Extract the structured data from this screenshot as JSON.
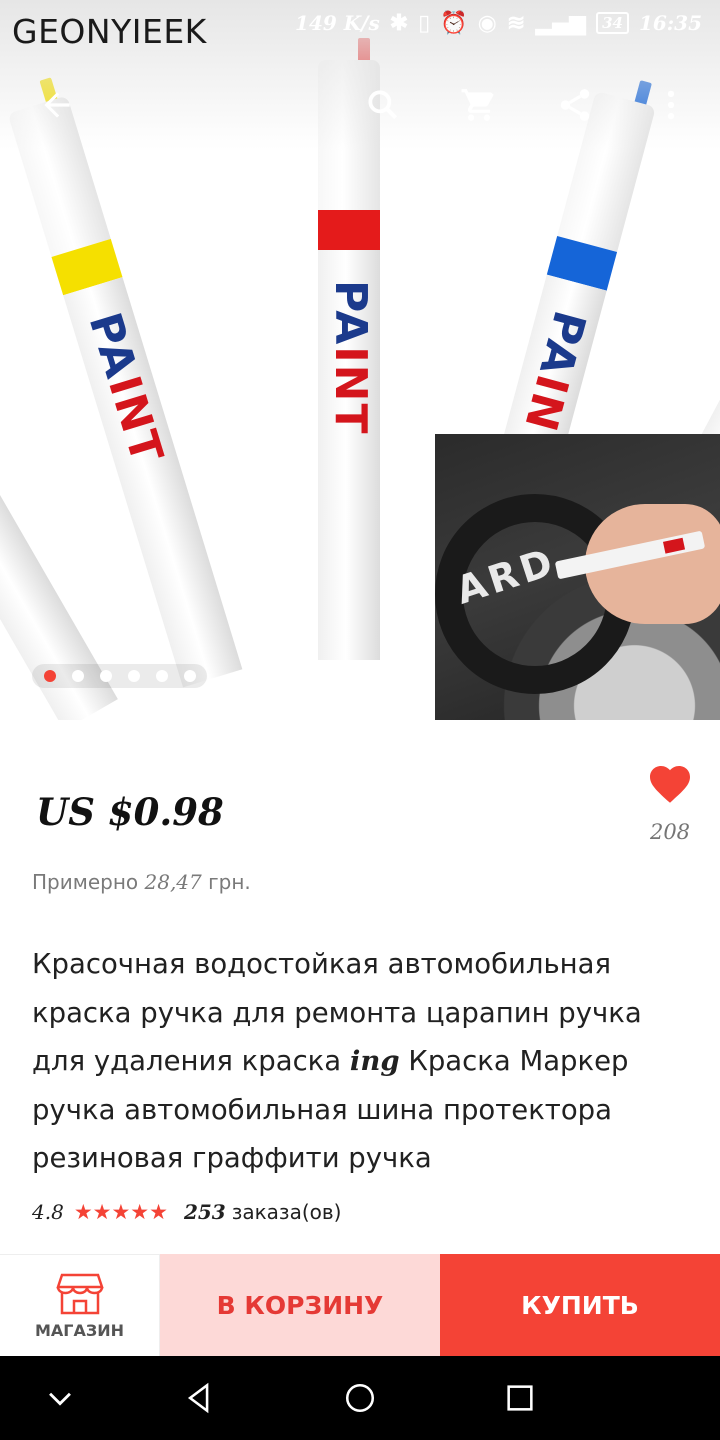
{
  "status_bar": {
    "brand": "GEONYIEEK",
    "speed": "149 K/s",
    "battery": "34",
    "time": "16:35"
  },
  "actionbar": {
    "icons": [
      "back-arrow-icon",
      "search-icon",
      "cart-icon",
      "share-icon",
      "more-icon"
    ]
  },
  "gallery": {
    "marker_text_top": "PA",
    "marker_text_bottom": "INT",
    "dot_count": 6,
    "active_dot": 0,
    "marker_colors": [
      "#ffffff",
      "#f5e000",
      "#e41b1b",
      "#1565d8",
      "#111111"
    ]
  },
  "product": {
    "price": "US $0.98",
    "wish_count": "208",
    "approx_prefix": "Примерно",
    "approx_value": "28,47",
    "approx_suffix": "грн.",
    "title_part1": "Красочная водостойкая автомобильная краска ручка для ремонта царапин ручка для удаления краска",
    "title_ing": "ing",
    "title_part2": "Краска Маркер ручка автомобильная шина протектора резиновая граффити ручка",
    "rating": "4.8",
    "stars": "★★★★★",
    "orders": "253",
    "orders_label": "заказа(ов)"
  },
  "bottom_bar": {
    "shop_label": "МАГАЗИН",
    "cart_label": "В КОРЗИНУ",
    "buy_label": "КУПИТЬ"
  },
  "colors": {
    "accent": "#f44336",
    "cart_bg": "#fdd9d7"
  }
}
